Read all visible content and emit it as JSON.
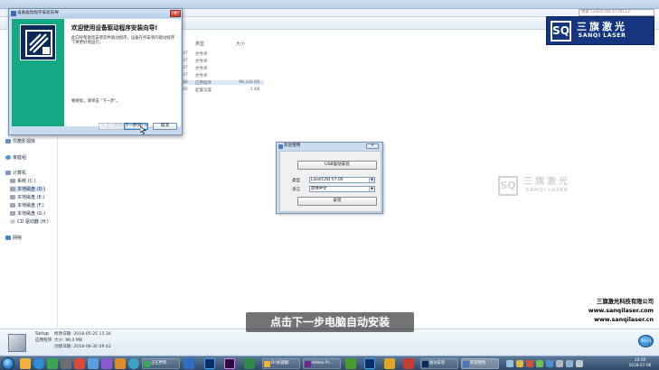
{
  "explorer": {
    "search_placeholder": "搜索 LaserCAD V7.00.12",
    "nav": {
      "video_library": "优酷影视库",
      "homegroup": "家庭组",
      "computer": "计算机",
      "drives": [
        "系统 (C:)",
        "本地磁盘 (D:)",
        "本地磁盘 (E:)",
        "本地磁盘 (F:)",
        "本地磁盘 (G:)",
        "CD 驱动器 (H:)"
      ],
      "network": "网络"
    },
    "columns": {
      "type": "类型",
      "size": "大小"
    },
    "files": [
      {
        "date_frag": "37",
        "type": "文件夹",
        "size": ""
      },
      {
        "date_frag": "37",
        "type": "文件夹",
        "size": ""
      },
      {
        "date_frag": "37",
        "type": "文件夹",
        "size": ""
      },
      {
        "date_frag": "37",
        "type": "文件夹",
        "size": ""
      },
      {
        "date_frag": "36",
        "type": "应用程序",
        "size": "98,326 KB"
      },
      {
        "date_frag": "40",
        "type": "配置设置",
        "size": "1 KB"
      }
    ]
  },
  "details": {
    "name": "Setup",
    "app_type": "应用程序",
    "modified": "修改日期: 2018-05-25 15:36",
    "size": "大小: 96.0 MB",
    "created": "创建日期: 2018-06-30 09:42"
  },
  "wizard": {
    "title": "设备驱动程序安装向导",
    "close": "✕",
    "heading": "欢迎使用设备驱动程序安装向导!",
    "description": "此向导帮助您安装软件驱动程序，设备在所安装的驱动程序下将更好地运行。",
    "hint": "要继续，请单击 \"下一步\"。",
    "back_button": "< 上一步(B)",
    "next_button": "下一步(N) >",
    "cancel_button": "取消"
  },
  "welcome": {
    "title": "欢迎使用",
    "close": "✕",
    "install_driver_button": "USB驱动安装",
    "type_label": "类型",
    "type_value": "LaserCAD V7.00",
    "language_label": "语言",
    "language_value": "简体中文",
    "install_button": "安装"
  },
  "watermark": {
    "mark": "SQ",
    "cn": "三旗激光",
    "en": "SANQI LASER"
  },
  "company": {
    "name": "三旗激光科技有限公司",
    "site1": "www.sanqilaser.com",
    "site2": "www.sanqilaser.cn"
  },
  "subtitle": "点击下一步电脑自动安装",
  "badge": "00:23",
  "taskbar": {
    "items": [
      "正在更新...",
      "D:\\机器翻...",
      "Adobe Pr...",
      "驱动安装",
      "欢迎使用"
    ],
    "time": "14:39",
    "date": "2018-07-06"
  },
  "colors": {
    "accent": "#14a884",
    "brand": "#15357e",
    "wizard_bg": "#c9dcef"
  }
}
